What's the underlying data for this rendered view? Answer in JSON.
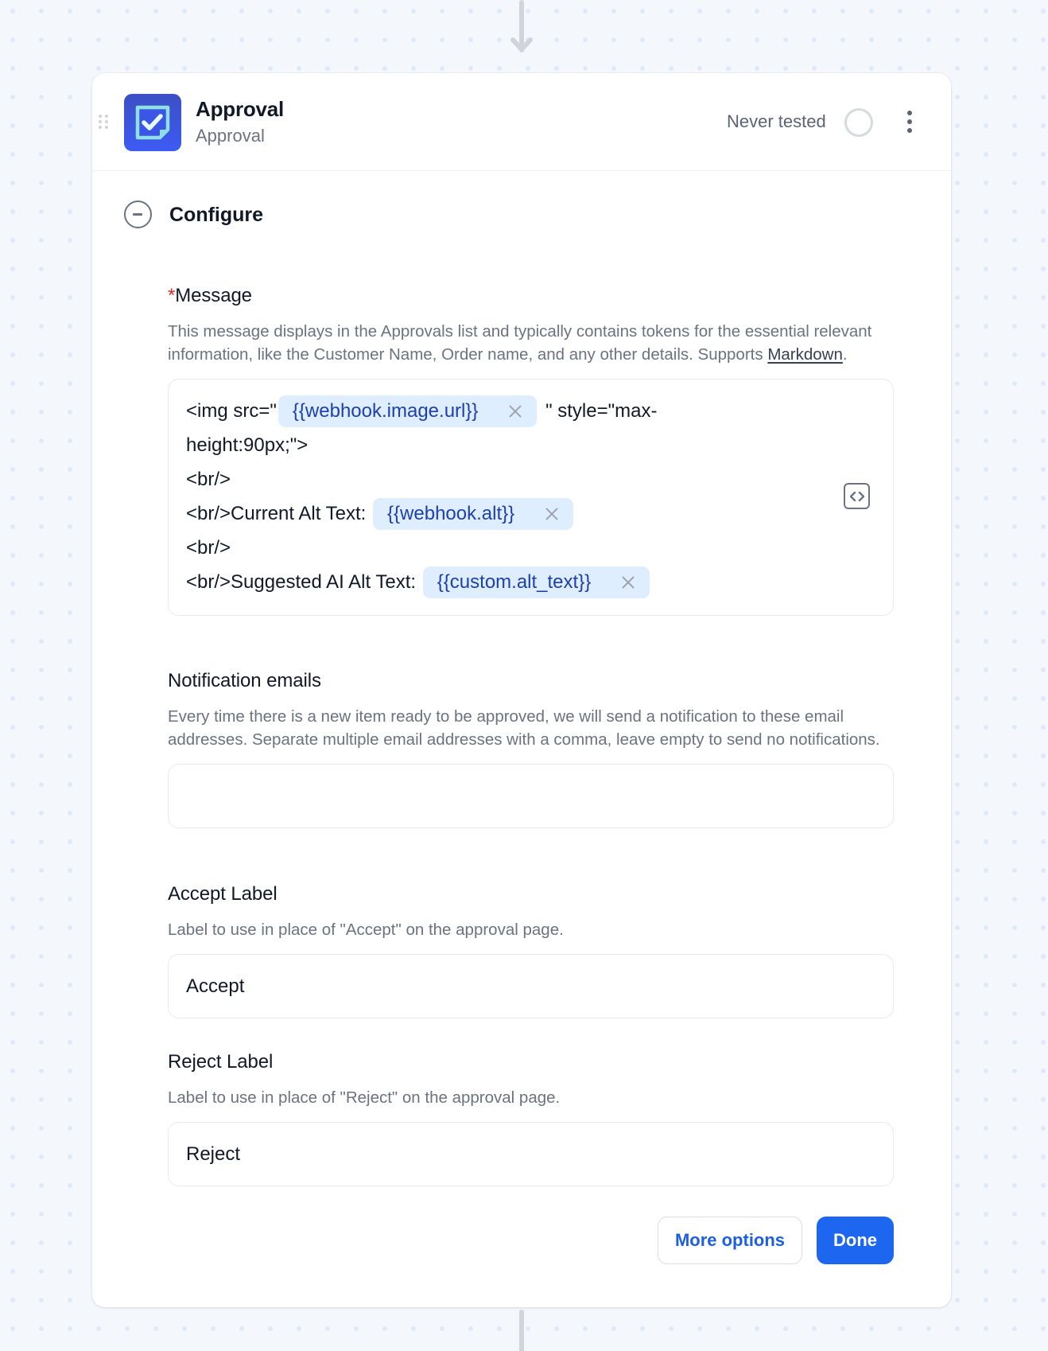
{
  "canvas": {
    "colors": {
      "background": "#f4f8fd",
      "dot": "#dde9f8",
      "connector": "#d1d5db"
    }
  },
  "step": {
    "title": "Approval",
    "subtitle": "Approval",
    "icon": "approval-checkbox-icon",
    "test_status": "Never tested",
    "colors": {
      "icon_bg": "#3d5bf5",
      "icon_fg": "#8ee0e3"
    }
  },
  "configure": {
    "label": "Configure",
    "icon": "collapse-minus-circle-icon"
  },
  "fields": {
    "message": {
      "required_mark": "*",
      "label": "Message",
      "description": "This message displays in the Approvals list and typically contains tokens for the essential relevant information, like the Customer Name, Order name, and any other details. Supports ",
      "description_link": "Markdown",
      "description_end": ".",
      "lines": [
        {
          "before": "<img src=\"",
          "token": "{{webhook.image.url}}",
          "after": " \" style=\"max-"
        },
        {
          "before": "height:90px;\">"
        },
        {
          "before": "<br/>"
        },
        {
          "before": "<br/>Current Alt Text: ",
          "token": "{{webhook.alt}}"
        },
        {
          "before": "<br/>"
        },
        {
          "before": "<br/>Suggested AI Alt Text: ",
          "token": "{{custom.alt_text}}"
        }
      ],
      "code_toggle_icon": "code-brackets-icon"
    },
    "notification_emails": {
      "label": "Notification emails",
      "description": "Every time there is a new item ready to be approved, we will send a notification to these email addresses. Separate multiple email addresses with a comma, leave empty to send no notifications.",
      "value": ""
    },
    "accept_label": {
      "label": "Accept Label",
      "description": "Label to use in place of \"Accept\" on the approval page.",
      "value": "Accept"
    },
    "reject_label": {
      "label": "Reject Label",
      "description": "Label to use in place of \"Reject\" on the approval page.",
      "value": "Reject"
    }
  },
  "actions": {
    "more_options": "More options",
    "done": "Done",
    "colors": {
      "primary": "#1d66f0",
      "link": "#1d5fe0"
    }
  }
}
